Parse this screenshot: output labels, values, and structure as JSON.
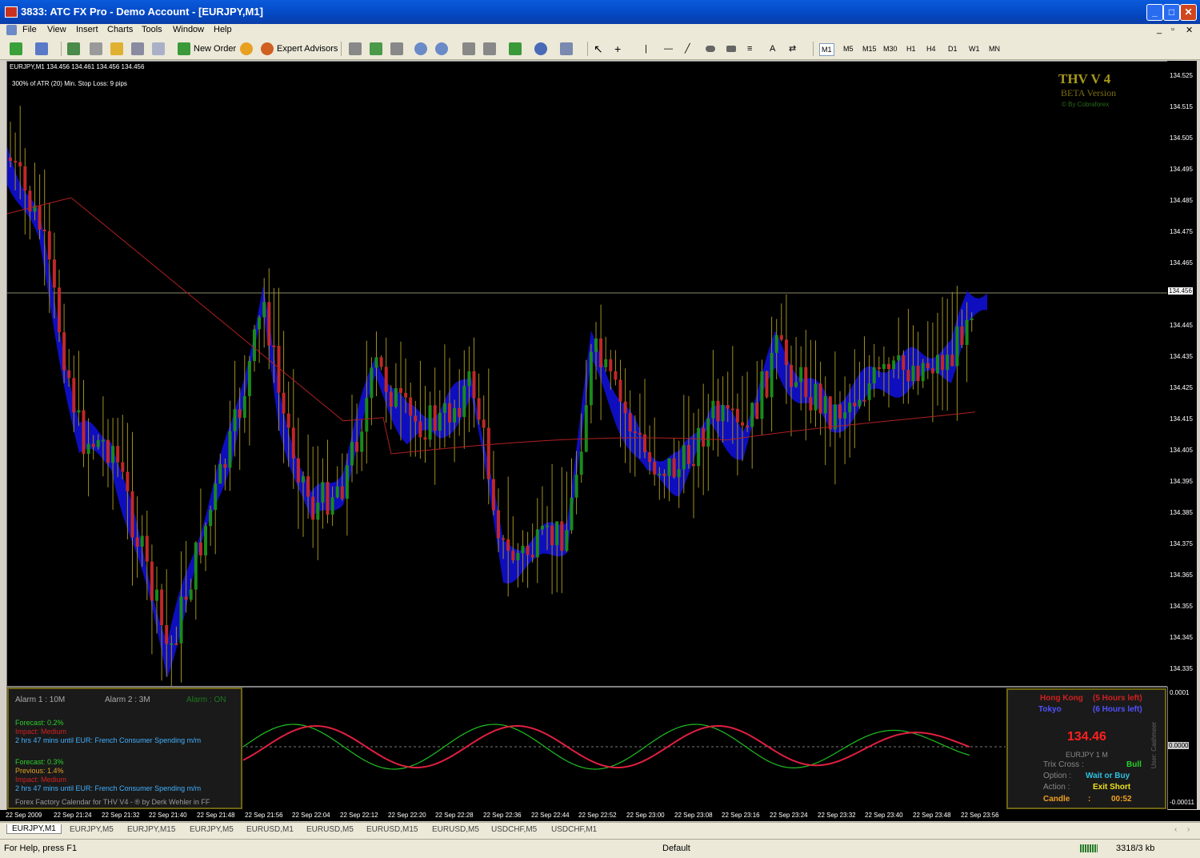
{
  "window": {
    "title": "3833: ATC FX Pro - Demo Account - [EURJPY,M1]",
    "minimize": "_",
    "maximize": "□",
    "close": "✕"
  },
  "menu": [
    "File",
    "View",
    "Insert",
    "Charts",
    "Tools",
    "Window",
    "Help"
  ],
  "toolbar": {
    "new_order": "New Order",
    "expert_advisors": "Expert Advisors",
    "timeframes": [
      "M1",
      "M5",
      "M15",
      "M30",
      "H1",
      "H4",
      "D1",
      "W1",
      "MN"
    ],
    "active_timeframe": "M1"
  },
  "chart": {
    "symbol_line": "EURJPY,M1  134.456  134.461  134.456  134.456",
    "atr_line": "300% of ATR (20)     Min. Stop Loss:   9 pips",
    "brand_title": "THV V 4",
    "brand_sub": "BETA Version",
    "brand_credit": "© By Cobraforex",
    "current_price": "134.456",
    "price_labels": [
      "134.525",
      "134.515",
      "134.505",
      "134.495",
      "134.485",
      "134.475",
      "134.465",
      "134.445",
      "134.435",
      "134.425",
      "134.415",
      "134.405",
      "134.395",
      "134.385",
      "134.375",
      "134.365",
      "134.355",
      "134.345",
      "134.335"
    ],
    "colors": {
      "bull": "#1a8a1a",
      "bear": "#c02828",
      "cloud": "#1010e0",
      "wick": "#a09020"
    }
  },
  "indicator": {
    "alarm1": "Alarm 1 : 10M",
    "alarm2": "Alarm 2 : 3M",
    "alarm_state": "Alarm : ON",
    "news1_forecast": "Forecast: 0.2%",
    "news1_impact": "Impact: Medium",
    "news1_text": "2 hrs 47 mins until EUR: French Consumer Spending m/m",
    "news2_forecast": "Forecast: 0.3%",
    "news2_previous": "Previous: 1.4%",
    "news2_impact": "Impact: Medium",
    "news2_text": "2 hrs 47 mins until EUR: French Consumer Spending m/m",
    "calendar_credit": "Forex Factory Calendar for THV V4 - ® by Derk Wehler in FF",
    "scale_top": "0.0001",
    "scale_mid": "0.0000",
    "scale_bottom": "-0.00011"
  },
  "session": {
    "hk_label": "Hong Kong",
    "hk_left": "(5 Hours left)",
    "tokyo_label": "Tokyo",
    "tokyo_left": "(6 Hours left)",
    "price": "134.46",
    "pair": "EURJPY  1 M",
    "trix_label": "Trix Cross  :",
    "trix_value": "Bull",
    "option_label": "Option  :",
    "option_value": "Wait or Buy",
    "action_label": "Action  :",
    "action_value": "Exit Short",
    "candle_label": "Candle",
    "candle_sep": ":",
    "candle_value": "00:52",
    "user": "User: Cashmeer"
  },
  "time_labels": [
    "22 Sep 2009",
    "22 Sep 21:24",
    "22 Sep 21:32",
    "22 Sep 21:40",
    "22 Sep 21:48",
    "22 Sep 21:56",
    "22 Sep 22:04",
    "22 Sep 22:12",
    "22 Sep 22:20",
    "22 Sep 22:28",
    "22 Sep 22:36",
    "22 Sep 22:44",
    "22 Sep 22:52",
    "22 Sep 23:00",
    "22 Sep 23:08",
    "22 Sep 23:16",
    "22 Sep 23:24",
    "22 Sep 23:32",
    "22 Sep 23:40",
    "22 Sep 23:48",
    "22 Sep 23:56"
  ],
  "tabs": [
    "EURJPY,M1",
    "EURJPY,M5",
    "EURJPY,M15",
    "EURJPY,M5",
    "EURUSD,M1",
    "EURUSD,M5",
    "EURUSD,M15",
    "EURUSD,M5",
    "USDCHF,M5",
    "USDCHF,M1"
  ],
  "status": {
    "help": "For Help, press F1",
    "profile": "Default",
    "traffic": "3318/3 kb"
  }
}
